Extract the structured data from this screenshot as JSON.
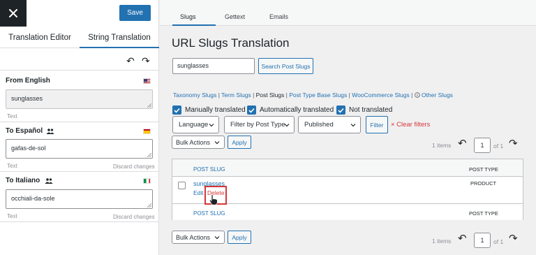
{
  "left_panel": {
    "save_label": "Save",
    "tabs": [
      "Translation Editor",
      "String Translation"
    ],
    "from": {
      "label": "From English",
      "value": "sunglasses",
      "hint": "Text"
    },
    "targets": [
      {
        "label": "To Español",
        "value": "gafas-de-sol",
        "hint": "Text",
        "discard": "Discard changes"
      },
      {
        "label": "To Italiano",
        "value": "occhiali-da-sole",
        "hint": "Text",
        "discard": "Discard changes"
      }
    ]
  },
  "right_panel": {
    "tabs": [
      "Slugs",
      "Gettext",
      "Emails"
    ],
    "title": "URL Slugs Translation",
    "search": {
      "value": "sunglasses",
      "button": "Search Post Slugs"
    },
    "slug_types": {
      "taxonomy": "Taxonomy Slugs",
      "term": "Term Slugs",
      "post": "Post Slugs",
      "post_type_base": "Post Type Base Slugs",
      "woocommerce": "WooCommerce Slugs",
      "other": "Other Slugs"
    },
    "checkboxes": [
      "Manually translated",
      "Automatically translated",
      "Not translated"
    ],
    "filters": {
      "language": "Language",
      "post_type": "Filter by Post Type",
      "status": "Published",
      "filter_button": "Filter",
      "clear": "× Clear filters"
    },
    "bulk_actions": "Bulk Actions",
    "apply": "Apply",
    "pagination": {
      "items": "1 items",
      "page": "1",
      "of": "of 1"
    },
    "table": {
      "col_slug": "POST SLUG",
      "col_type": "POST TYPE",
      "rows": [
        {
          "slug": "sunglasses",
          "type": "PRODUCT",
          "edit": "Edit",
          "delete": "Delete"
        }
      ]
    }
  },
  "colors": {
    "accent": "#2271b1",
    "danger": "#d63638",
    "dark": "#1d2327"
  }
}
